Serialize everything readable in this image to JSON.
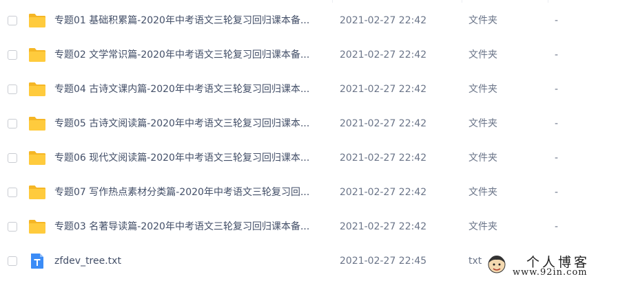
{
  "files": [
    {
      "name": "专题01 基础积累篇-2020年中考语文三轮复习回归课本备...",
      "modified": "2021-02-27 22:42",
      "type": "文件夹",
      "size": "-",
      "icon": "folder-icon"
    },
    {
      "name": "专题02 文学常识篇-2020年中考语文三轮复习回归课本备...",
      "modified": "2021-02-27 22:42",
      "type": "文件夹",
      "size": "-",
      "icon": "folder-icon"
    },
    {
      "name": "专题04 古诗文课内篇-2020年中考语文三轮复习回归课本...",
      "modified": "2021-02-27 22:42",
      "type": "文件夹",
      "size": "-",
      "icon": "folder-icon"
    },
    {
      "name": "专题05 古诗文阅读篇-2020年中考语文三轮复习回归课本...",
      "modified": "2021-02-27 22:42",
      "type": "文件夹",
      "size": "-",
      "icon": "folder-icon"
    },
    {
      "name": "专题06 现代文阅读篇-2020年中考语文三轮复习回归课本...",
      "modified": "2021-02-27 22:42",
      "type": "文件夹",
      "size": "-",
      "icon": "folder-icon"
    },
    {
      "name": "专题07 写作热点素材分类篇-2020年中考语文三轮复习回...",
      "modified": "2021-02-27 22:42",
      "type": "文件夹",
      "size": "-",
      "icon": "folder-icon"
    },
    {
      "name": "专题03 名著导读篇-2020年中考语文三轮复习回归课本备...",
      "modified": "2021-02-27 22:42",
      "type": "文件夹",
      "size": "-",
      "icon": "folder-icon"
    },
    {
      "name": "zfdev_tree.txt",
      "modified": "2021-02-27 22:45",
      "type": "txt",
      "size": "",
      "icon": "text-file-icon"
    }
  ],
  "watermark": {
    "title": "个人博客",
    "url": "www.92in.com"
  },
  "colors": {
    "folder": "#FFCB3D",
    "folder_tab": "#F5B625",
    "txt_file": "#3B8CF6",
    "text": "#424E67",
    "muted": "#6A7488"
  }
}
